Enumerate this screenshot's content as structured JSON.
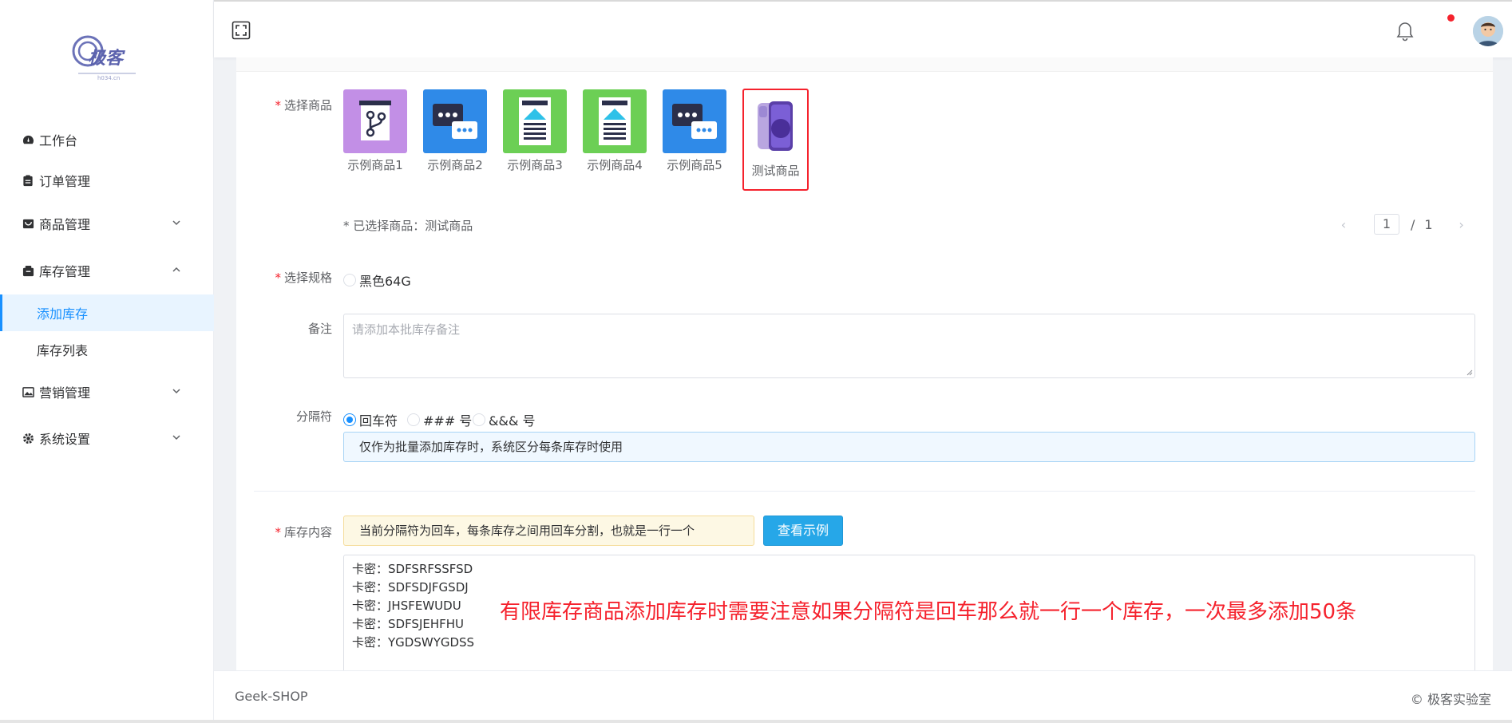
{
  "logo": {
    "text": "极客",
    "subtext": "h034.cn"
  },
  "sidebar": {
    "items": [
      {
        "label": "工作台",
        "icon": "dashboard-icon"
      },
      {
        "label": "订单管理",
        "icon": "order-icon"
      },
      {
        "label": "商品管理",
        "icon": "shop-icon",
        "expandable": true
      },
      {
        "label": "库存管理",
        "icon": "inventory-icon",
        "expandable": true,
        "expanded": true
      },
      {
        "label": "营销管理",
        "icon": "picture-icon",
        "expandable": true
      },
      {
        "label": "系统设置",
        "icon": "gear-icon",
        "expandable": true
      }
    ],
    "sub_items": [
      {
        "label": "添加库存",
        "active": true
      },
      {
        "label": "库存列表",
        "active": false
      }
    ]
  },
  "form": {
    "select_product_label": "选择商品",
    "products": [
      {
        "name": "示例商品1",
        "icon": "branch-icon",
        "color": "#c28fe6"
      },
      {
        "name": "示例商品2",
        "icon": "chat-icon",
        "color": "#2f8ae8"
      },
      {
        "name": "示例商品3",
        "icon": "document-icon",
        "color": "#6ccf55"
      },
      {
        "name": "示例商品4",
        "icon": "document-icon",
        "color": "#6ccf55"
      },
      {
        "name": "示例商品5",
        "icon": "chat-icon",
        "color": "#2f8ae8"
      },
      {
        "name": "测试商品",
        "icon": "phone-icon",
        "selected": true
      }
    ],
    "selected_note": "* 已选择商品：测试商品",
    "pager": {
      "current": "1",
      "separator": "/",
      "total": "1"
    },
    "spec_label": "选择规格",
    "spec_option": "黑色64G",
    "remark_label": "备注",
    "remark_placeholder": "请添加本批库存备注",
    "separator_label": "分隔符",
    "separator_options": [
      "回车符",
      "### 号",
      "&&& 号"
    ],
    "separator_selected": "回车符",
    "separator_hint": "仅作为批量添加库存时，系统区分每条库存时使用",
    "stock_label": "库存内容",
    "stock_warning": "当前分隔符为回车，每条库存之间用回车分割，也就是一行一个",
    "example_button": "查看示例",
    "stock_lines": [
      "卡密：SDFSRFSSFSD",
      "卡密：SDFSDJFGSDJ",
      "卡密：JHSFEWUDU",
      "卡密：SDFSJEHFHU",
      "卡密：YGDSWYGDSS"
    ],
    "annotation": "有限库存商品添加库存时需要注意如果分隔符是回车那么就一行一个库存，一次最多添加50条"
  },
  "footer": {
    "left": "Geek-SHOP",
    "right": "© 极客实验室"
  },
  "colors": {
    "accent": "#1890ff",
    "danger": "#f5222d",
    "button": "#26a7e8"
  }
}
